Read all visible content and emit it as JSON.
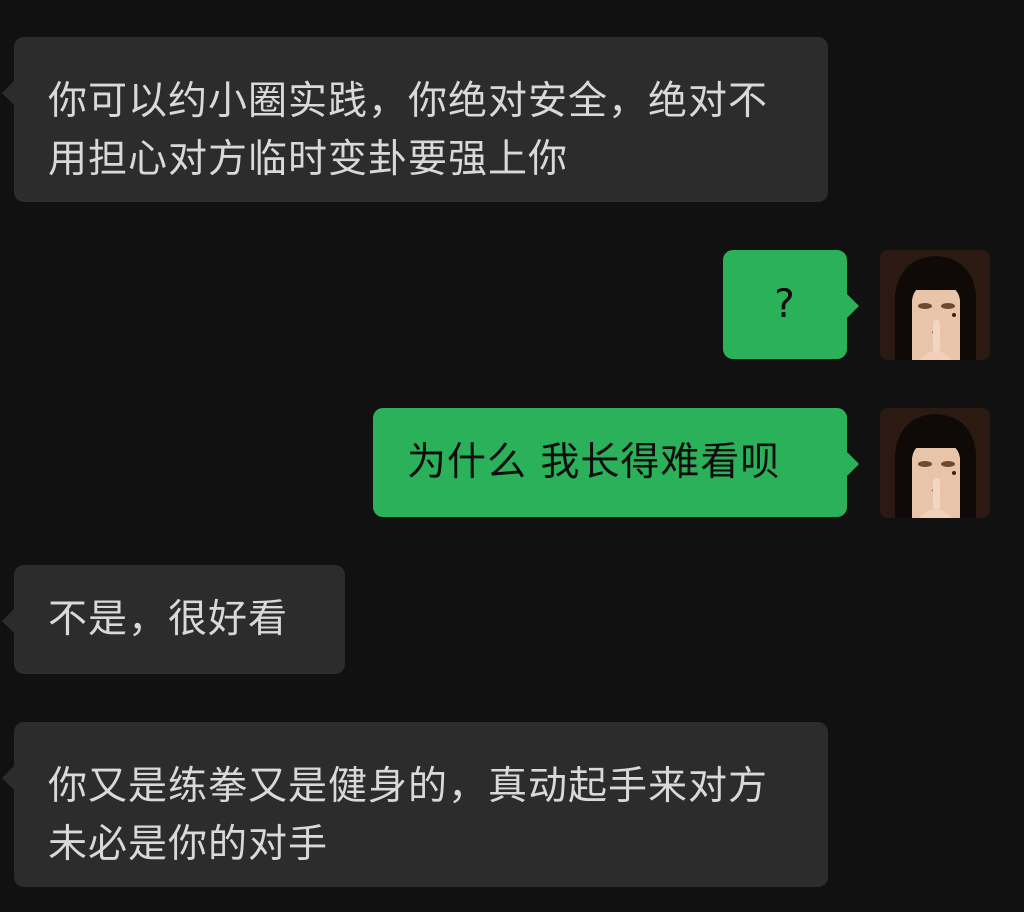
{
  "messages": [
    {
      "direction": "incoming",
      "text": "你可以约小圈实践，你绝对安全，绝对不用担心对方临时变卦要强上你"
    },
    {
      "direction": "outgoing",
      "text": "?"
    },
    {
      "direction": "outgoing",
      "text": "为什么 我长得难看呗"
    },
    {
      "direction": "incoming",
      "text": "不是，很好看"
    },
    {
      "direction": "incoming",
      "text": "你又是练拳又是健身的，真动起手来对方未必是你的对手"
    }
  ],
  "colors": {
    "background": "#111111",
    "incoming_bubble": "#2c2c2c",
    "outgoing_bubble": "#2bb15a"
  },
  "icons": {
    "user_avatar": "avatar-illustrated-girl-finger-on-lips"
  }
}
